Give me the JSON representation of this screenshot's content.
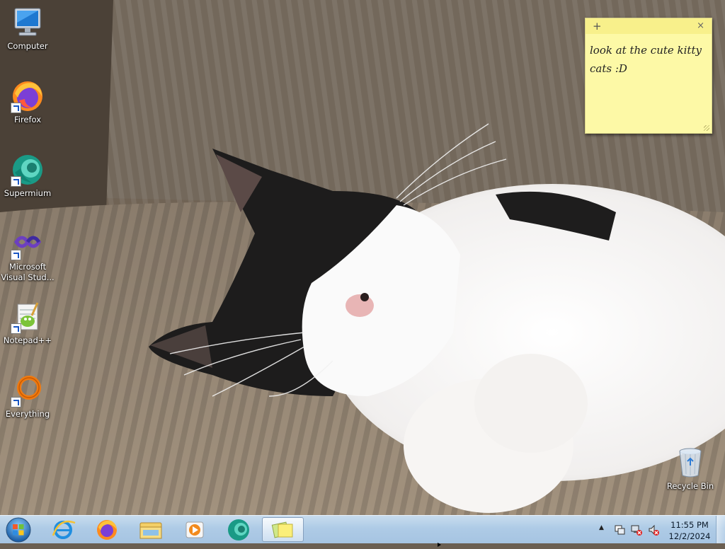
{
  "desktop": {
    "icons": [
      {
        "label": "Computer",
        "icon": "computer-icon"
      },
      {
        "label": "Firefox",
        "icon": "firefox-icon"
      },
      {
        "label": "Supermium",
        "icon": "supermium-icon"
      },
      {
        "label": "Microsoft Visual Stud...",
        "icon": "visual-studio-icon"
      },
      {
        "label": "Notepad++",
        "icon": "notepadpp-icon"
      },
      {
        "label": "Everything",
        "icon": "everything-icon"
      },
      {
        "label": "Recycle Bin",
        "icon": "recycle-bin-icon"
      }
    ]
  },
  "sticky_note": {
    "add_icon": "+",
    "close_icon": "×",
    "text": "look at the cute kitty cats :D",
    "color": "#fdf9a6"
  },
  "taskbar": {
    "start_icon": "windows-orb-icon",
    "pinned": [
      {
        "icon": "internet-explorer-icon"
      },
      {
        "icon": "firefox-icon"
      },
      {
        "icon": "file-explorer-icon"
      },
      {
        "icon": "media-player-icon"
      },
      {
        "icon": "supermium-icon"
      },
      {
        "icon": "sticky-notes-icon",
        "active": true
      }
    ],
    "tray": {
      "chevron": "▲",
      "icons": [
        "action-center-icon",
        "network-disconnected-icon",
        "volume-muted-icon"
      ]
    },
    "clock": {
      "time": "11:55 PM",
      "date": "12/2/2024"
    }
  }
}
